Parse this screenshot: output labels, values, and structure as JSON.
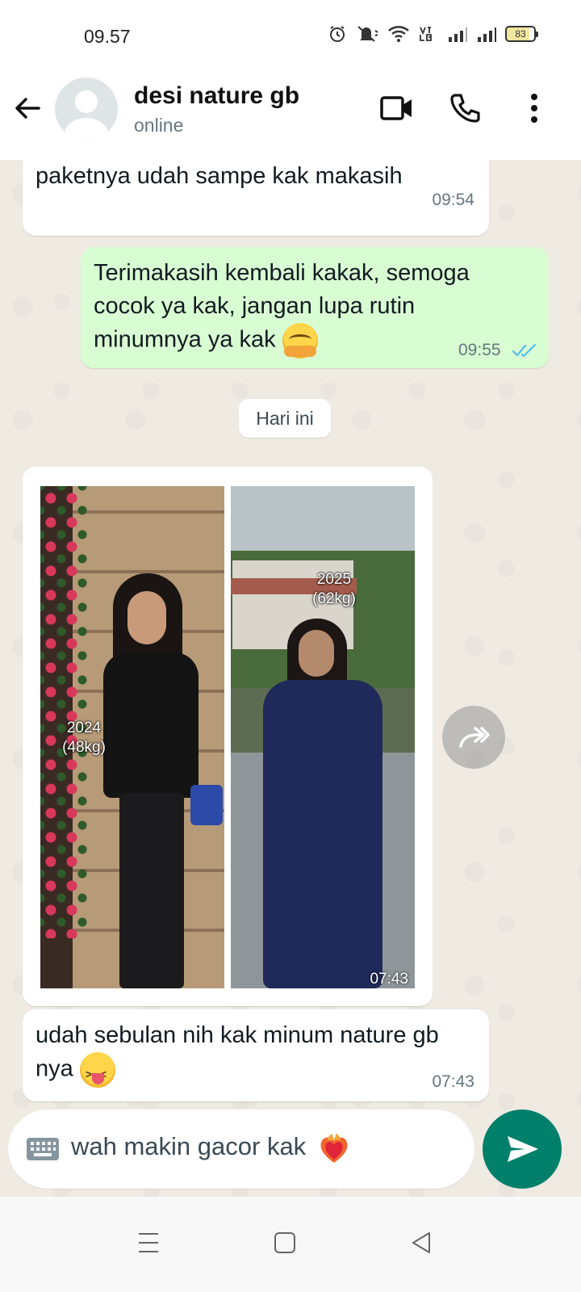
{
  "status_bar": {
    "time": "09.57",
    "network_label": "Vo) LTE2",
    "battery": "83"
  },
  "header": {
    "contact_name": "desi nature gb",
    "contact_status": "online"
  },
  "messages": [
    {
      "direction": "in",
      "text": "paketnya udah sampe kak makasih",
      "time": "09:54"
    },
    {
      "direction": "out",
      "lines": [
        "Terimakasih kembali kakak, semoga",
        "cocok ya kak, jangan lupa rutin",
        "minumnya ya kak"
      ],
      "emoji": "hugging-face",
      "time": "09:55",
      "status": "read"
    },
    {
      "direction": "in",
      "type": "image",
      "captions": {
        "left_year": "2024",
        "left_weight": "(48kg)",
        "right_year": "2025",
        "right_weight": "(62kg)"
      },
      "time": "07:43"
    },
    {
      "direction": "in",
      "lines": [
        "udah sebulan nih kak minum nature gb",
        "nya"
      ],
      "emoji": "squinting-tongue-face",
      "time": "07:43"
    }
  ],
  "day_separator": "Hari ini",
  "composer": {
    "draft_text": "wah makin gacor kak",
    "draft_emoji": "heart-on-fire"
  },
  "colors": {
    "accent": "#00806a",
    "outgoing_bubble": "#d9fdd3",
    "incoming_bubble": "#ffffff",
    "chat_background": "#efeae2",
    "read_ticks": "#53bdeb"
  },
  "icons": {
    "back": "arrow-left-icon",
    "video": "video-camera-icon",
    "call": "phone-icon",
    "menu": "more-vertical-icon",
    "forward": "forward-icon",
    "keyboard": "keyboard-icon",
    "send": "send-icon"
  }
}
